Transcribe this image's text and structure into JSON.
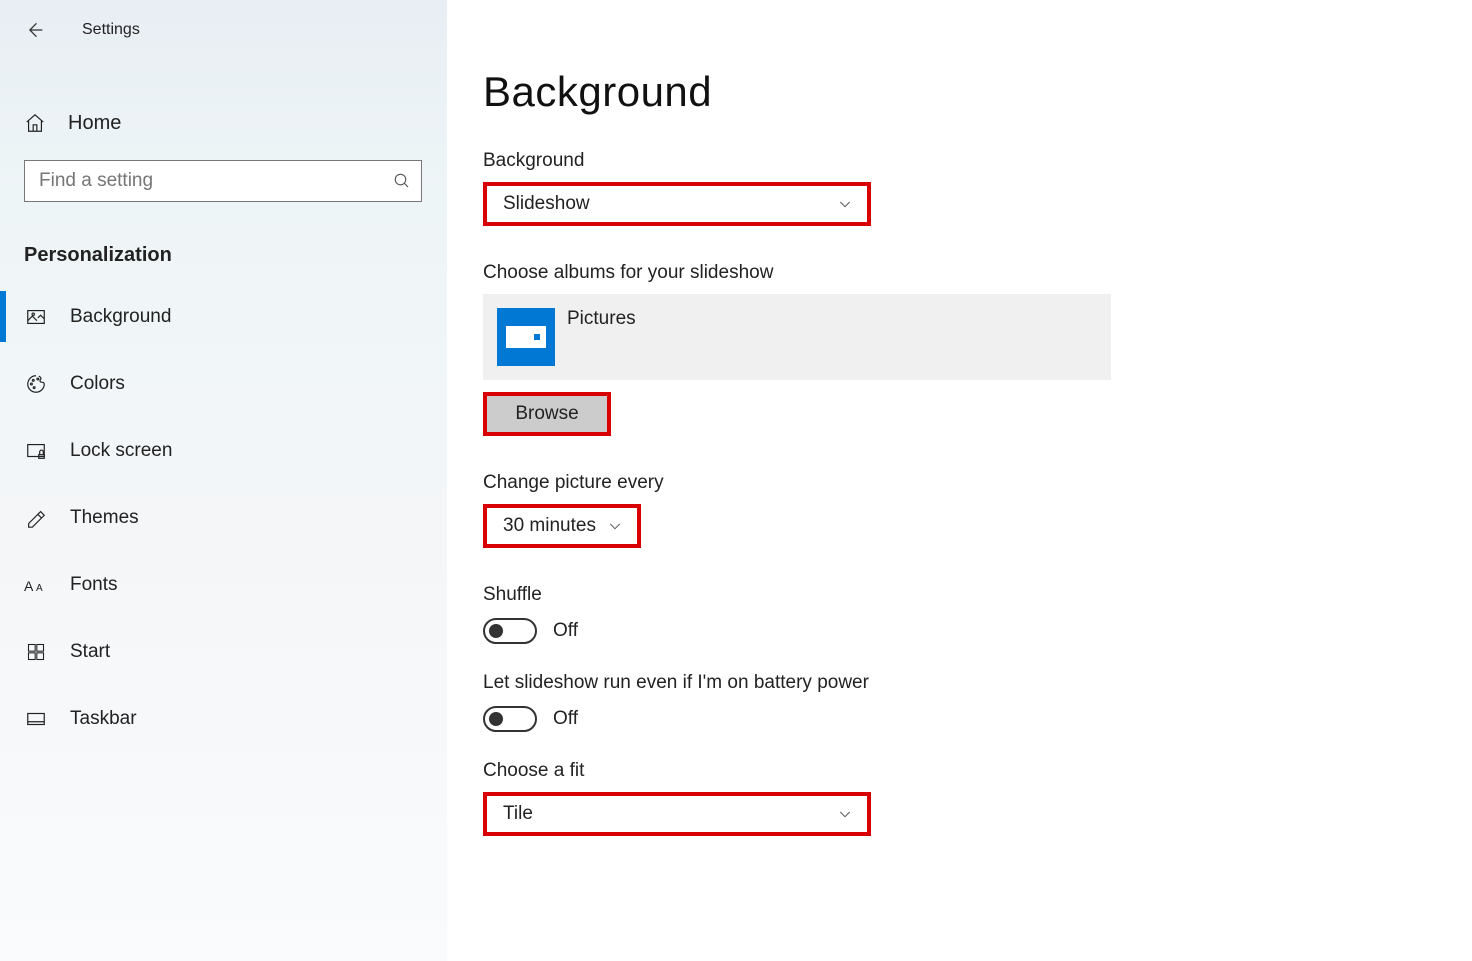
{
  "app": {
    "title": "Settings"
  },
  "sidebar": {
    "home": "Home",
    "search_placeholder": "Find a setting",
    "category": "Personalization",
    "items": [
      {
        "label": "Background",
        "active": true
      },
      {
        "label": "Colors"
      },
      {
        "label": "Lock screen"
      },
      {
        "label": "Themes"
      },
      {
        "label": "Fonts"
      },
      {
        "label": "Start"
      },
      {
        "label": "Taskbar"
      }
    ]
  },
  "page": {
    "title": "Background",
    "background_label": "Background",
    "background_value": "Slideshow",
    "choose_albums_label": "Choose albums for your slideshow",
    "album_name": "Pictures",
    "browse_label": "Browse",
    "change_every_label": "Change picture every",
    "change_every_value": "30 minutes",
    "shuffle_label": "Shuffle",
    "shuffle_state": "Off",
    "battery_label": "Let slideshow run even if I'm on battery power",
    "battery_state": "Off",
    "fit_label": "Choose a fit",
    "fit_value": "Tile"
  }
}
